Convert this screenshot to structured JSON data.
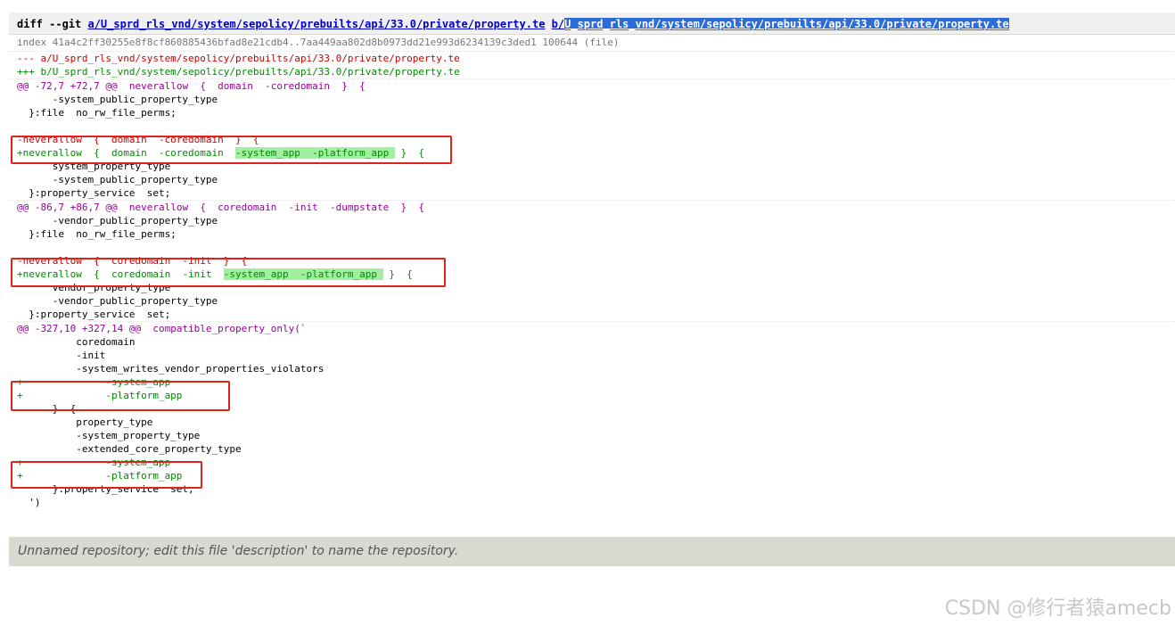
{
  "diff_header": {
    "prefix": "diff --git ",
    "link_a": "a/U_sprd_rls_vnd/system/sepolicy/prebuilts/api/33.0/private/property.te",
    "link_b_prefix": "b/",
    "link_b_selected": "U_sprd_rls_vnd/system/sepolicy/prebuilts/api/33.0/private/property.te"
  },
  "index_line": "index 41a4c2ff30255e8f8cf860885436bfad8e21cdb4..7aa449aa802d8b0973dd21e993d6234139c3ded1 100644 (file)",
  "from_file": "--- a/U_sprd_rls_vnd/system/sepolicy/prebuilts/api/33.0/private/property.te",
  "to_file": "+++ b/U_sprd_rls_vnd/system/sepolicy/prebuilts/api/33.0/private/property.te",
  "hunks": [
    {
      "header": "@@ -72,7 +72,7 @@",
      "header_ctx": "neverallow  {  domain  -coredomain  }  {",
      "lines": [
        {
          "type": "ctx",
          "text": "      -system_public_property_type"
        },
        {
          "type": "ctx",
          "text": "  }:file  no_rw_file_perms;"
        },
        {
          "type": "ctx",
          "text": " "
        },
        {
          "type": "del",
          "text": "-neverallow  {  domain  -coredomain  }  {"
        },
        {
          "type": "add",
          "pre": "+neverallow  {  domain  -coredomain  ",
          "hl": "-system_app  -platform_app ",
          "post": " }  {"
        },
        {
          "type": "ctx",
          "text": "      system_property_type"
        },
        {
          "type": "ctx",
          "text": "      -system_public_property_type"
        },
        {
          "type": "ctx",
          "text": "  }:property_service  set;"
        }
      ]
    },
    {
      "header": "@@ -86,7 +86,7 @@",
      "header_ctx": "neverallow  {  coredomain  -init  -dumpstate  }  {",
      "lines": [
        {
          "type": "ctx",
          "text": "      -vendor_public_property_type"
        },
        {
          "type": "ctx",
          "text": "  }:file  no_rw_file_perms;"
        },
        {
          "type": "ctx",
          "text": " "
        },
        {
          "type": "del",
          "text": "-neverallow  {  coredomain  -init  }  {"
        },
        {
          "type": "add",
          "pre": "+neverallow  {  coredomain  -init  ",
          "hl": "-system_app  -platform_app ",
          "post": " }  {"
        },
        {
          "type": "ctx",
          "text": "      vendor_property_type"
        },
        {
          "type": "ctx",
          "text": "      -vendor_public_property_type"
        },
        {
          "type": "ctx",
          "text": "  }:property_service  set;"
        }
      ]
    },
    {
      "header": "@@ -327,10 +327,14 @@",
      "header_ctx": "compatible_property_only(`",
      "lines": [
        {
          "type": "ctx",
          "text": "          coredomain"
        },
        {
          "type": "ctx",
          "text": "          -init"
        },
        {
          "type": "ctx",
          "text": "          -system_writes_vendor_properties_violators"
        },
        {
          "type": "add",
          "text": "+              -system_app"
        },
        {
          "type": "add",
          "text": "+              -platform_app"
        },
        {
          "type": "ctx",
          "text": "      }  {"
        },
        {
          "type": "ctx",
          "text": "          property_type"
        },
        {
          "type": "ctx",
          "text": "          -system_property_type"
        },
        {
          "type": "ctx",
          "text": "          -extended_core_property_type"
        },
        {
          "type": "add",
          "text": "+              -system_app"
        },
        {
          "type": "add",
          "text": "+              -platform_app"
        },
        {
          "type": "ctx",
          "text": "      }:property_service  set;"
        },
        {
          "type": "ctx",
          "text": "  ')"
        }
      ]
    }
  ],
  "footer_text": "Unnamed repository; edit this file 'description' to name the repository.",
  "watermark": "CSDN @修行者猿amecb",
  "colors": {
    "deleted": "#cc0000",
    "added": "#008800",
    "chunk_header": "#990099",
    "highlight_added": "#a0f0a0",
    "annotation_box": "#e0221d"
  }
}
